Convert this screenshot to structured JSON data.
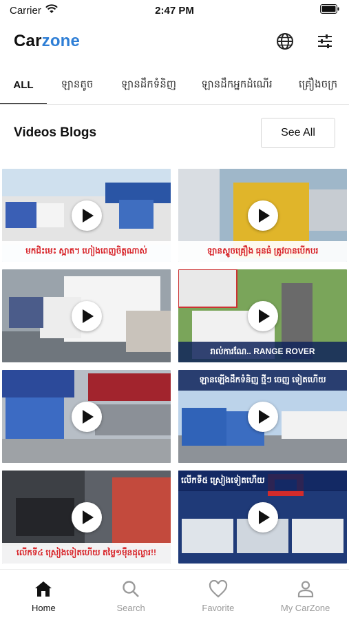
{
  "status_bar": {
    "carrier": "Carrier",
    "time": "2:47 PM"
  },
  "header": {
    "logo_part1": "Car",
    "logo_part2": "zone",
    "brand_color": "#2f7fd6"
  },
  "tabs": [
    {
      "label": "ALL",
      "active": true
    },
    {
      "label": "ឡានតូច",
      "active": false
    },
    {
      "label": "ឡានដឹកទំនិញ",
      "active": false
    },
    {
      "label": "ឡានដឹកអ្នកដំណើរ",
      "active": false
    },
    {
      "label": "គ្រឿងចក្រ",
      "active": false
    }
  ],
  "section": {
    "title": "Videos Blogs",
    "see_all": "See All"
  },
  "videos": [
    {
      "caption": "មកជិះមេះ ស្អាត។ ហៀងពេញចិត្តណាស់"
    },
    {
      "caption": "ឡានស្ទូចគ្រឿង ធុនធំ ត្រូវបានបើកបរ"
    },
    {
      "caption": ""
    },
    {
      "caption": "រាល់ការណែ.. RANGE ROVER"
    },
    {
      "caption": ""
    },
    {
      "caption": "ឡានឡើងដឹកទំនិញ ថ្មីៗ ចេញ ទៀតហើយ"
    },
    {
      "caption": "លើកទី៤ ស្រៀងទៀតហើយ តម្លៃ១ម៉ឺនដុល្លារ!!"
    },
    {
      "caption": "លើកទី៥ ស្រៀងទៀតហើយ"
    }
  ],
  "bottom_nav": [
    {
      "label": "Home",
      "active": true
    },
    {
      "label": "Search",
      "active": false
    },
    {
      "label": "Favorite",
      "active": false
    },
    {
      "label": "My CarZone",
      "active": false
    }
  ]
}
